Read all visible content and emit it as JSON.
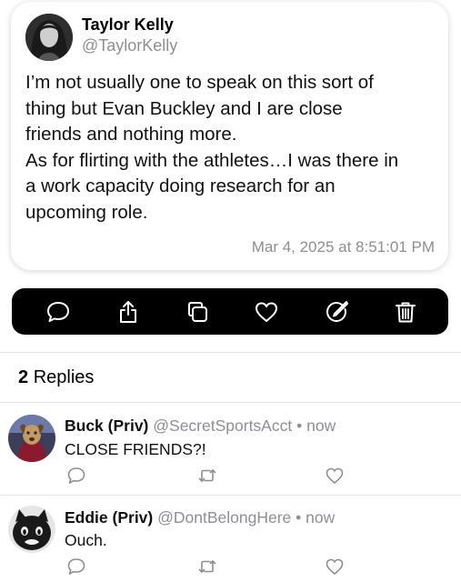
{
  "tweet": {
    "author_name": "Taylor Kelly",
    "author_handle": "@TaylorKelly",
    "lines": [
      "I’m not usually one to speak on this sort of",
      "thing but Evan Buckley and I are close",
      "friends and nothing more.",
      "As for flirting with the athletes…I was there in",
      "a work capacity doing research for an",
      "upcoming role."
    ],
    "timestamp": "Mar 4, 2025 at 8:51:01 PM"
  },
  "action_bar": {
    "icons": [
      "reply-icon",
      "share-icon",
      "copy-icon",
      "like-icon",
      "edit-icon",
      "delete-icon"
    ]
  },
  "replies_header": {
    "count": "2",
    "label": "Replies"
  },
  "replies": [
    {
      "name": "Buck (Priv)",
      "handle": "@SecretSportsAcct",
      "dot": "•",
      "time": "now",
      "text": "CLOSE FRIENDS?!"
    },
    {
      "name": "Eddie (Priv)",
      "handle": "@DontBelongHere",
      "dot": "•",
      "time": "now",
      "text": "Ouch."
    }
  ]
}
